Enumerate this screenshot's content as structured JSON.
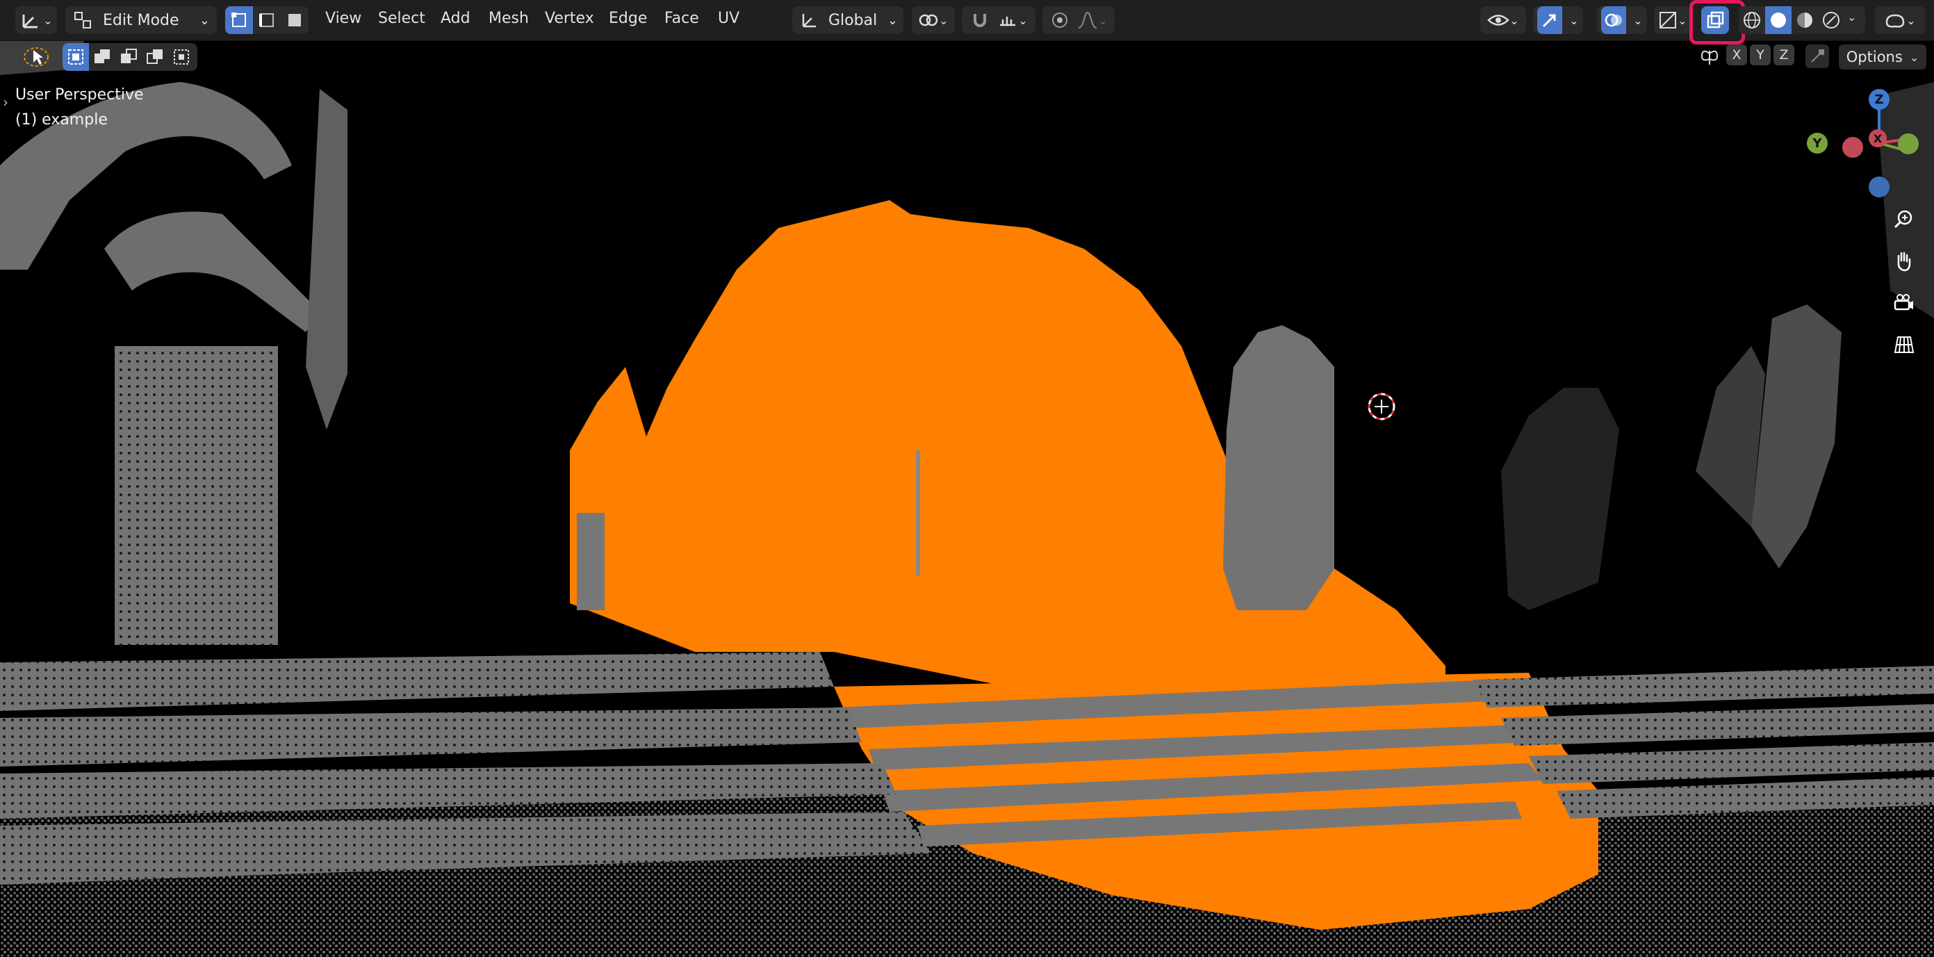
{
  "header": {
    "mode_label": "Edit Mode",
    "menus": [
      "View",
      "Select",
      "Add",
      "Mesh",
      "Vertex",
      "Edge",
      "Face",
      "UV"
    ],
    "transform_orientation": "Global",
    "options_label": "Options",
    "axis_x": "X",
    "axis_y": "Y",
    "axis_z": "Z"
  },
  "viewport": {
    "perspective_label": "User Perspective",
    "object_label": "(1) example"
  },
  "gizmo": {
    "z": "Z",
    "y": "Y",
    "x": "X"
  },
  "colors": {
    "selection_orange": "#ff7f00",
    "mesh_gray": "#777777",
    "header_bg": "#1f1f1f",
    "active_blue": "#4a78c9",
    "highlight_red": "#e5195a"
  }
}
